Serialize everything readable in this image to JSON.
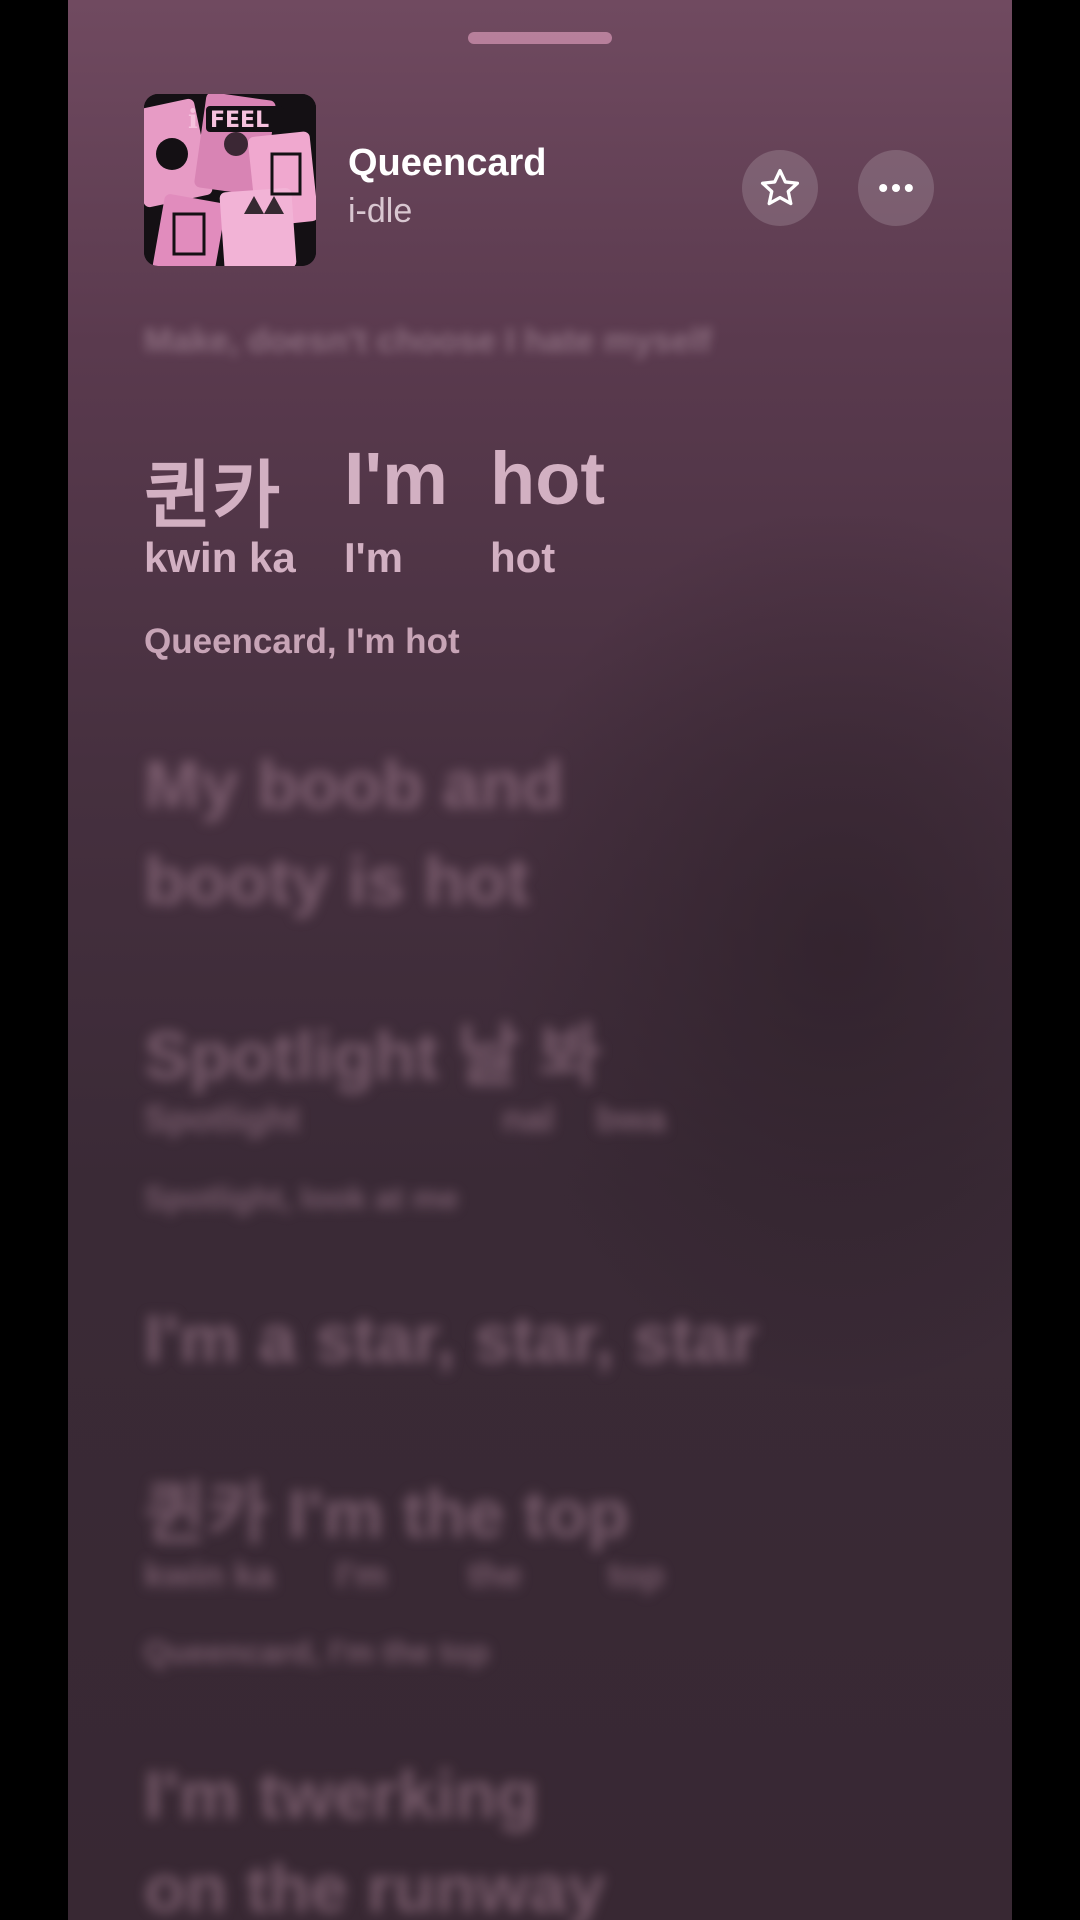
{
  "header": {
    "song_title": "Queencard",
    "artist": "i-dle",
    "artwork_name": "album-art-i-feel"
  },
  "icons": {
    "favorite": "star-outline-icon",
    "more": "ellipsis-icon"
  },
  "lyrics": {
    "previous_line": "Make, doesn't choose I hate myself",
    "current": {
      "words": [
        {
          "main": "퀸카",
          "romanized": "kwin ka"
        },
        {
          "main": "I'm",
          "romanized": "I'm"
        },
        {
          "main": "hot",
          "romanized": "hot"
        }
      ],
      "translation": "Queencard, I'm hot"
    },
    "upcoming": [
      {
        "lines": [
          "My boob and",
          "booty is hot"
        ]
      },
      {
        "main": "Spotlight 날 봐",
        "romanized": [
          "Spotlight",
          "nal",
          "bwa"
        ],
        "translation": "Spotlight, look at me"
      },
      {
        "lines": [
          "I'm a star, star, star"
        ]
      },
      {
        "main": "퀸카 I'm the top",
        "romanized": [
          "kwin ka",
          "I'm",
          "the",
          "top"
        ],
        "translation": "Queencard, I'm the top"
      },
      {
        "lines": [
          "I'm twerking",
          "on the runway"
        ]
      }
    ]
  },
  "colors": {
    "background_top": "#704a60",
    "background_bottom": "#382833",
    "active_lyric": "#d2b0c2",
    "grabber": "#c48aa6"
  }
}
